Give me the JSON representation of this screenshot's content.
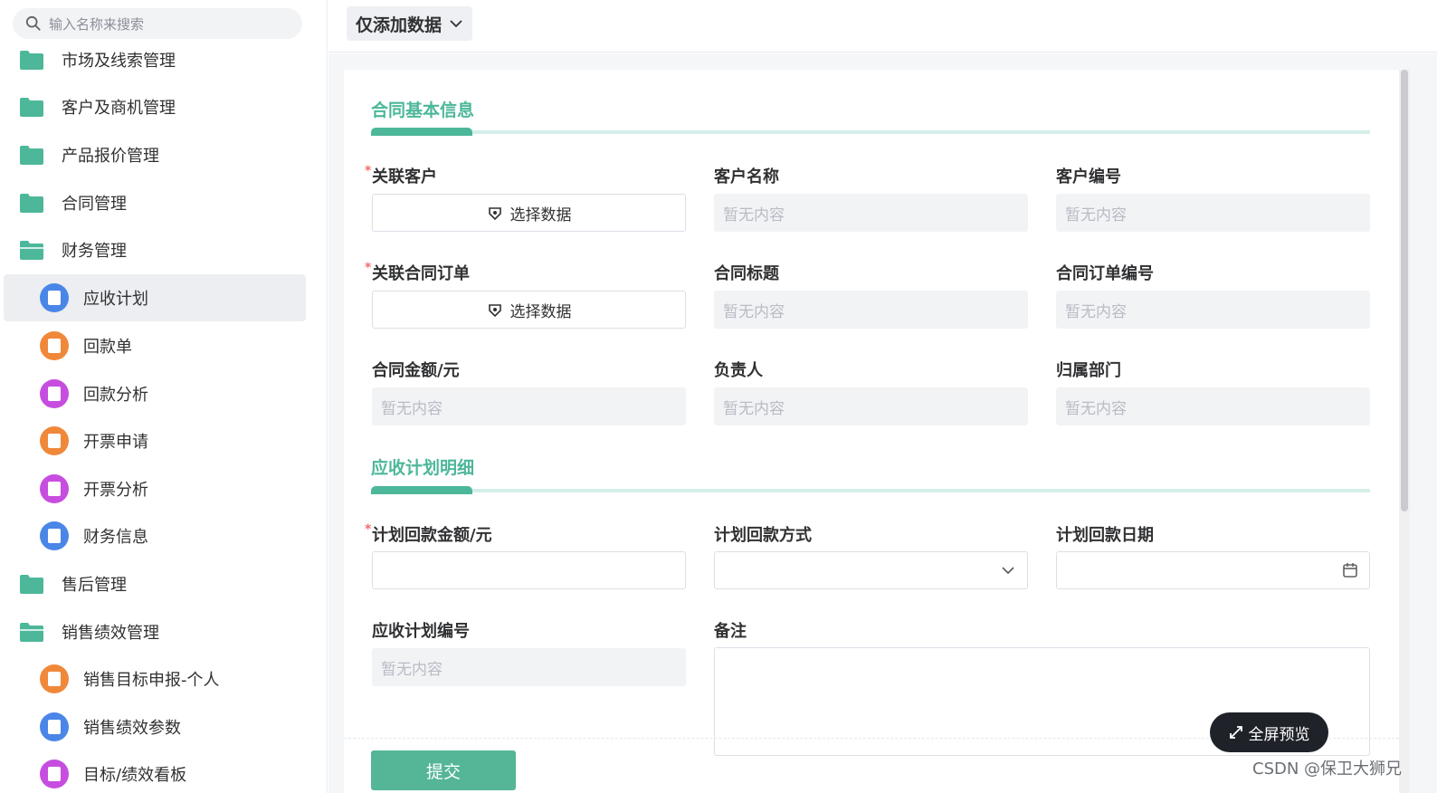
{
  "sidebar": {
    "search_placeholder": "输入名称来搜索",
    "items": [
      {
        "label": "市场及线索管理"
      },
      {
        "label": "客户及商机管理"
      },
      {
        "label": "产品报价管理"
      },
      {
        "label": "合同管理"
      },
      {
        "label": "财务管理"
      },
      {
        "label": "应收计划",
        "color": "#4a86e8"
      },
      {
        "label": "回款单",
        "color": "#f0883a"
      },
      {
        "label": "回款分析",
        "color": "#c74de0"
      },
      {
        "label": "开票申请",
        "color": "#f0883a"
      },
      {
        "label": "开票分析",
        "color": "#c74de0"
      },
      {
        "label": "财务信息",
        "color": "#4a86e8"
      },
      {
        "label": "售后管理"
      },
      {
        "label": "销售绩效管理"
      },
      {
        "label": "销售目标申报-个人",
        "color": "#f0883a"
      },
      {
        "label": "销售绩效参数",
        "color": "#4a86e8"
      },
      {
        "label": "目标/绩效看板",
        "color": "#c74de0"
      }
    ]
  },
  "topbar": {
    "mode_label": "仅添加数据"
  },
  "form": {
    "section1_title": "合同基本信息",
    "section2_title": "应收计划明细",
    "empty_text": "暂无内容",
    "select_data_label": "选择数据",
    "fields": {
      "customer": "关联客户",
      "customer_name": "客户名称",
      "customer_no": "客户编号",
      "order": "关联合同订单",
      "contract_title": "合同标题",
      "order_no": "合同订单编号",
      "amount": "合同金额/元",
      "owner": "负责人",
      "department": "归属部门",
      "plan_amount": "计划回款金额/元",
      "plan_method": "计划回款方式",
      "plan_date": "计划回款日期",
      "plan_no": "应收计划编号",
      "remark": "备注"
    },
    "required_mark": "*",
    "submit_label": "提交"
  },
  "fullscreen_label": "全屏预览",
  "watermark": "CSDN @保卫大狮兄",
  "colors": {
    "accent": "#4db79a",
    "folder": "#4db79a"
  }
}
